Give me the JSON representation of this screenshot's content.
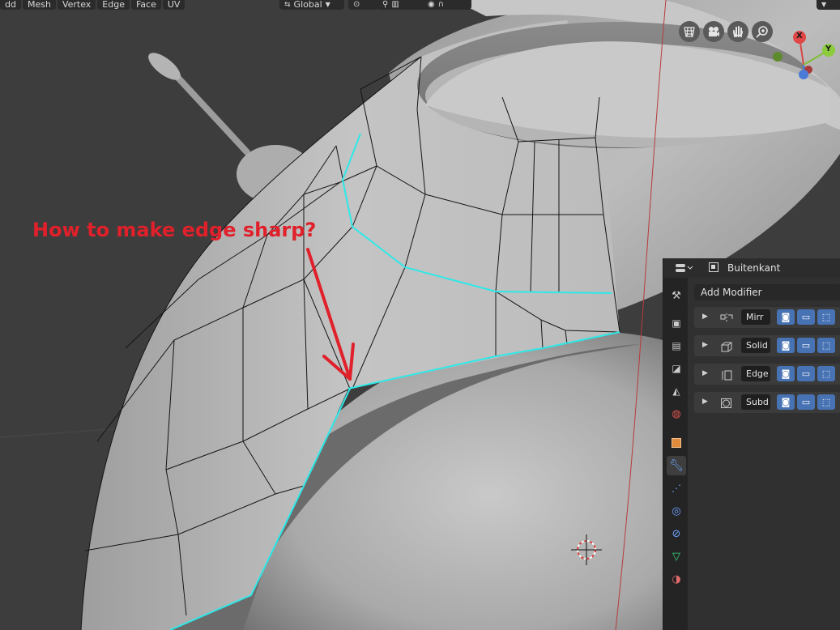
{
  "menubar": {
    "items": [
      "dd",
      "Mesh",
      "Vertex",
      "Edge",
      "Face",
      "UV"
    ]
  },
  "header": {
    "orientation": "Global"
  },
  "gizmo": {
    "x_label": "X",
    "y_label": "Y"
  },
  "annotation": {
    "text": "How to make edge sharp?"
  },
  "properties": {
    "object_name": "Buitenkant",
    "add_modifier_label": "Add Modifier",
    "modifiers": [
      {
        "name": "Mirr"
      },
      {
        "name": "Solid"
      },
      {
        "name": "Edge"
      },
      {
        "name": "Subd"
      }
    ],
    "tabs": [
      "tool-icon",
      "render-icon",
      "output-icon",
      "view-layer-icon",
      "scene-icon",
      "world-icon",
      "object-icon",
      "modifier-icon",
      "particles-icon",
      "physics-icon",
      "constraints-icon",
      "data-icon",
      "material-icon"
    ],
    "active_tab": "modifier-icon"
  },
  "colors": {
    "viewport_bg": "#3d3d3d",
    "selected_edge": "#2ee8e8",
    "annotation": "#e0202a",
    "toggle_blue": "#4772b3"
  }
}
